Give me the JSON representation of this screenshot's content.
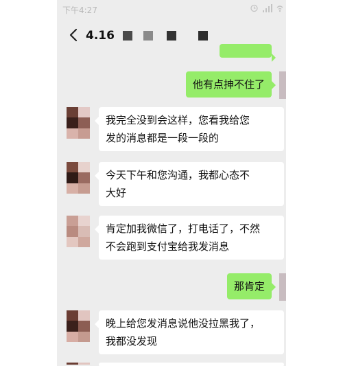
{
  "status_bar": {
    "time": "下午4:27"
  },
  "header": {
    "title": "4.16"
  },
  "messages": [
    {
      "side": "right",
      "text": "他有点抻不住了"
    },
    {
      "side": "left",
      "lines": [
        "我完全没到会这样，您看我给您",
        "发的消息都是一段一段的"
      ]
    },
    {
      "side": "left",
      "lines": [
        "今天下午和您沟通，我都心态不",
        "大好"
      ]
    },
    {
      "side": "left",
      "lines": [
        "肯定加我微信了，打电话了，不然",
        "不会跑到支付宝给我发消息"
      ]
    },
    {
      "side": "right",
      "text": "那肯定"
    },
    {
      "side": "left",
      "lines": [
        "晚上给您发消息说他没拉黑我了，",
        "我都没发现"
      ]
    }
  ],
  "icons": [
    "back-arrow-icon",
    "alarm-icon",
    "signal-icon",
    "wifi-icon"
  ],
  "colors": {
    "chat_bg": "#ededed",
    "self_bubble": "#95ec69",
    "other_bubble": "#ffffff"
  }
}
